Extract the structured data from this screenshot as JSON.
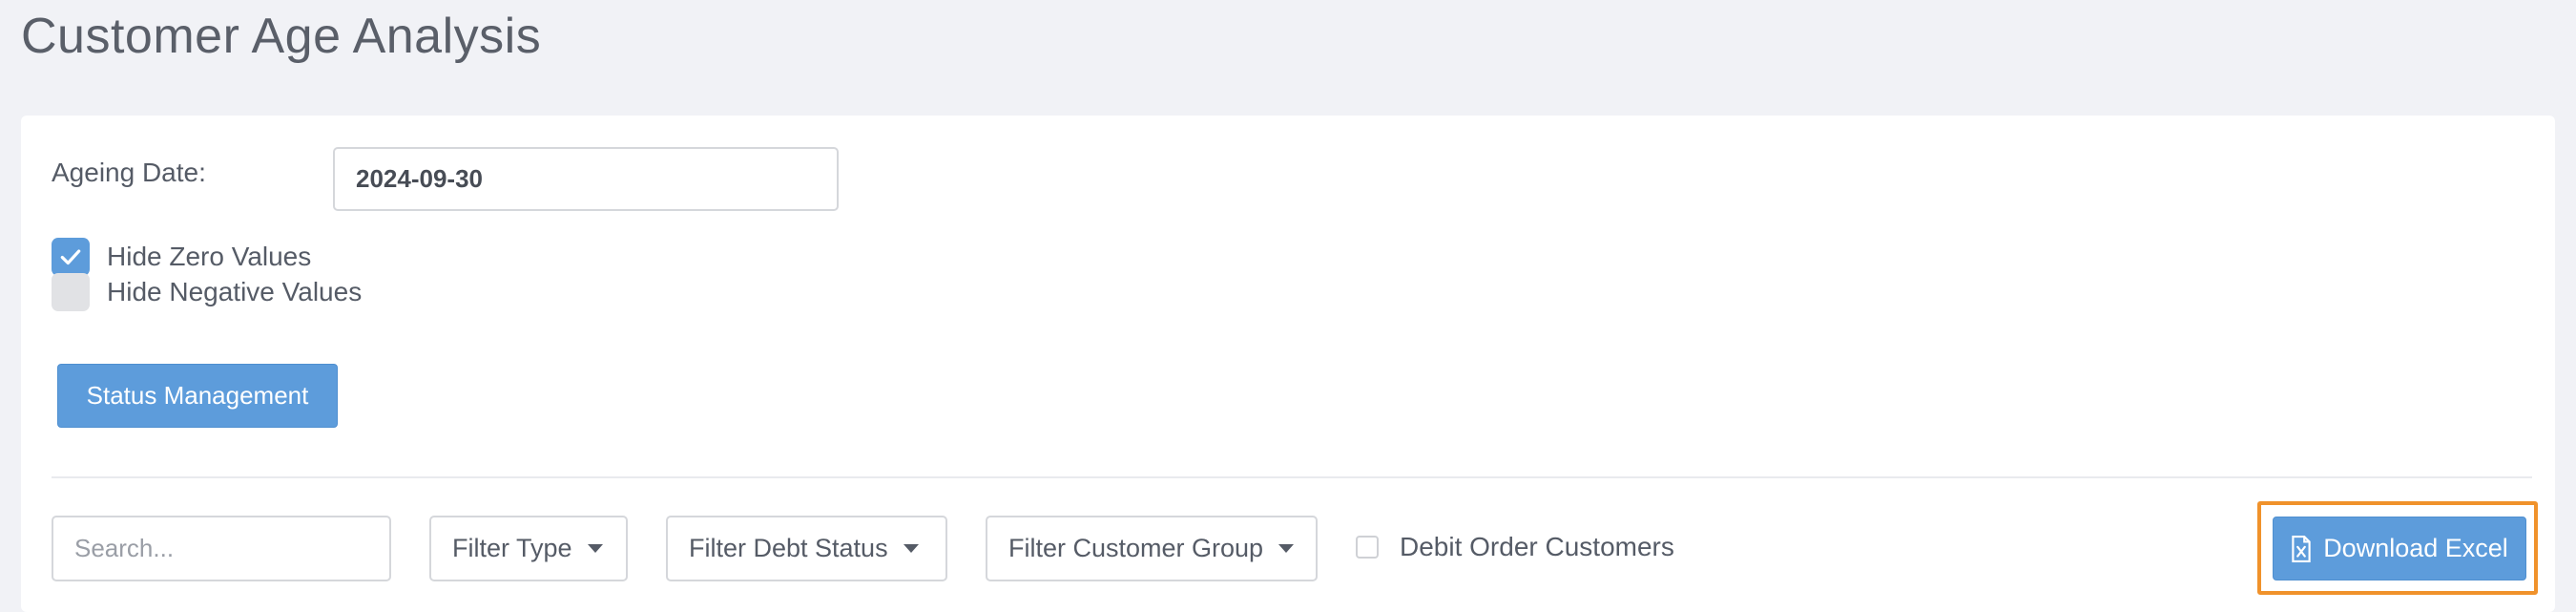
{
  "page": {
    "title": "Customer Age Analysis"
  },
  "filters": {
    "ageing_date_label": "Ageing Date:",
    "ageing_date_value": "2024-09-30",
    "hide_zero_label": "Hide Zero Values",
    "hide_zero_checked": true,
    "hide_negative_label": "Hide Negative Values",
    "hide_negative_checked": false,
    "status_management_label": "Status Management"
  },
  "toolbar": {
    "search_placeholder": "Search...",
    "filter_type_label": "Filter Type",
    "filter_debt_status_label": "Filter Debt Status",
    "filter_customer_group_label": "Filter Customer Group",
    "debit_order_label": "Debit Order Customers",
    "debit_order_checked": false,
    "download_excel_label": "Download Excel"
  },
  "colors": {
    "primary": "#5d9cdb",
    "highlight_border": "#f0922b",
    "background": "#f1f2f6"
  },
  "icons": {
    "checkmark": "check-icon",
    "dropdown": "caret-down-icon",
    "excel": "excel-file-icon"
  }
}
